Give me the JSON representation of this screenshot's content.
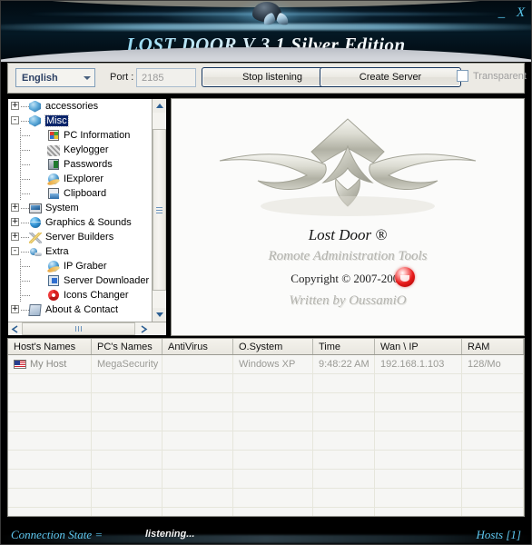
{
  "window": {
    "title": "LOST DOOR V 3.1 Silver Edition",
    "minimize_label": "_",
    "close_label": "X"
  },
  "toolbar": {
    "language": "English",
    "port_label": "Port :",
    "port_value": "2185",
    "stop_listening_label": "Stop listening",
    "create_server_label": "Create Server",
    "transparent_label": "Transparent"
  },
  "tree": {
    "nodes": [
      {
        "label": "accessories",
        "icon": "cube-icon",
        "expander": "+",
        "depth": 0,
        "selected": false
      },
      {
        "label": "Misc",
        "icon": "cube-icon",
        "expander": "-",
        "depth": 0,
        "selected": true
      },
      {
        "label": "PC Information",
        "icon": "windows-icon",
        "expander": "",
        "depth": 1,
        "selected": false
      },
      {
        "label": "Keylogger",
        "icon": "keyboard-icon",
        "expander": "",
        "depth": 1,
        "selected": false
      },
      {
        "label": "Passwords",
        "icon": "passwords-icon",
        "expander": "",
        "depth": 1,
        "selected": false
      },
      {
        "label": "IExplorer",
        "icon": "internet-explorer-icon",
        "expander": "",
        "depth": 1,
        "selected": false
      },
      {
        "label": "Clipboard",
        "icon": "clipboard-icon",
        "expander": "",
        "depth": 1,
        "selected": false
      },
      {
        "label": "System",
        "icon": "monitor-icon",
        "expander": "+",
        "depth": 0,
        "selected": false
      },
      {
        "label": "Graphics & Sounds",
        "icon": "globe-icon",
        "expander": "+",
        "depth": 0,
        "selected": false
      },
      {
        "label": "Server Builders",
        "icon": "tools-icon",
        "expander": "+",
        "depth": 0,
        "selected": false
      },
      {
        "label": "Extra",
        "icon": "extra-icon",
        "expander": "-",
        "depth": 0,
        "selected": false
      },
      {
        "label": "IP Graber",
        "icon": "internet-explorer-icon",
        "expander": "",
        "depth": 1,
        "selected": false
      },
      {
        "label": "Server Downloader",
        "icon": "download-icon",
        "expander": "",
        "depth": 1,
        "selected": false
      },
      {
        "label": "Icons Changer",
        "icon": "recycle-icon",
        "expander": "",
        "depth": 1,
        "selected": false
      },
      {
        "label": "About & Contact",
        "icon": "about-icon",
        "expander": "+",
        "depth": 0,
        "selected": false
      }
    ]
  },
  "logo": {
    "brand": "Lost Door ®",
    "tagline": "Romote Administration Tools",
    "copyright": "Copyright © 2007-2009",
    "author": "Written by OussamiO"
  },
  "table": {
    "columns": [
      {
        "label": "Host's Names",
        "width": 92
      },
      {
        "label": "PC's Names",
        "width": 78
      },
      {
        "label": "AntiVirus",
        "width": 78
      },
      {
        "label": "O.System",
        "width": 88
      },
      {
        "label": "Time",
        "width": 68
      },
      {
        "label": "Wan \\ IP",
        "width": 96
      },
      {
        "label": "RAM",
        "width": 68
      }
    ],
    "rows": [
      {
        "host": "My Host",
        "pc": "MegaSecurity",
        "antivirus": "",
        "os": "Windows XP",
        "time": "9:48:22 AM",
        "ip": "192.168.1.103",
        "ram": "128/Mo",
        "flag": "us-flag-icon"
      }
    ],
    "empty_row_count": 8
  },
  "status": {
    "connection_label": "Connection State =",
    "connection_value": "listening...",
    "hosts_label": "Hosts [1]"
  },
  "colors": {
    "accent_cyan": "#5ec7ef",
    "banner_dark": "#03121c",
    "selection_blue": "#0a246a",
    "button_border": "#12335c"
  }
}
